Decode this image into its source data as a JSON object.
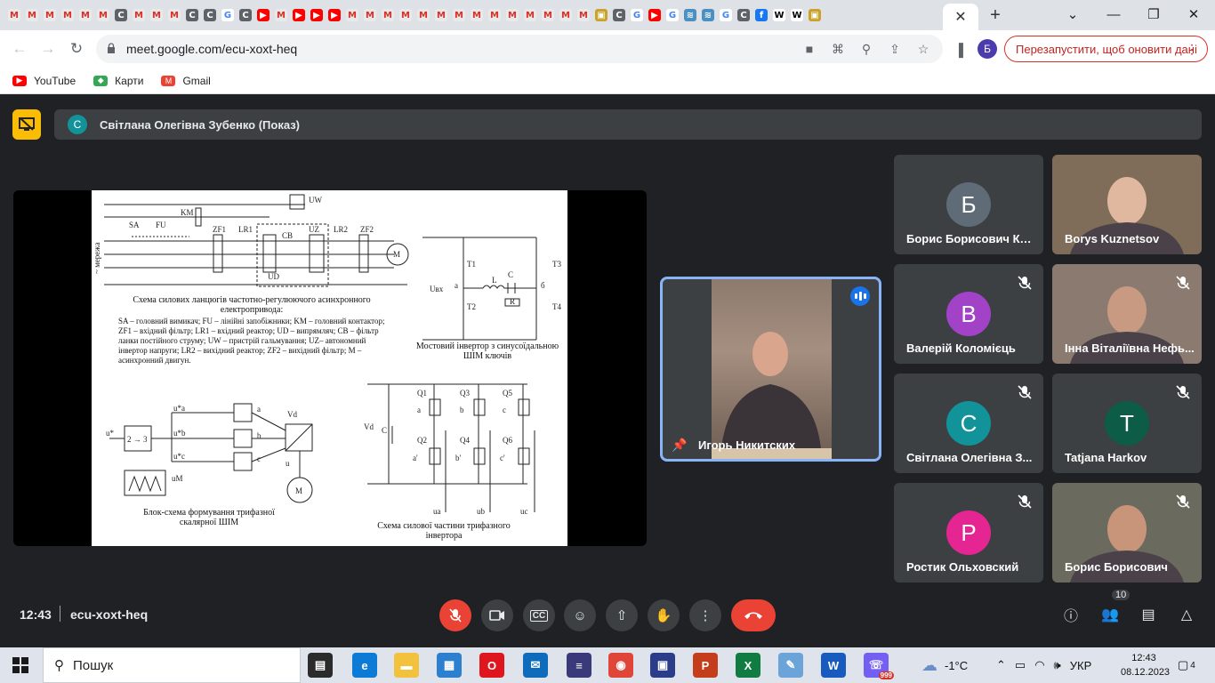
{
  "browser": {
    "active_tab_icon": "close-icon",
    "tab_favicons": [
      "M",
      "M",
      "M",
      "M",
      "M",
      "M",
      "C",
      "M",
      "M",
      "M",
      "C",
      "C",
      "G",
      "C",
      "▶",
      "M",
      "▶",
      "▶",
      "▶",
      "M",
      "M",
      "M",
      "M",
      "M",
      "M",
      "M",
      "M",
      "M",
      "M",
      "M",
      "M",
      "M",
      "M",
      "▣",
      "C",
      "G",
      "▶",
      "G",
      "≋",
      "≋",
      "G",
      "C",
      "f",
      "W",
      "W",
      "▣"
    ],
    "url": "meet.google.com/ecu-xoxt-heq",
    "profile_letter": "Б",
    "relaunch_label": "Перезапустити, щоб оновити дані",
    "bookmarks": [
      {
        "label": "YouTube",
        "color": "#ff0000",
        "icon": "youtube-icon"
      },
      {
        "label": "Карти",
        "color": "#34a853",
        "icon": "maps-icon"
      },
      {
        "label": "Gmail",
        "color": "#ea4335",
        "icon": "gmail-icon"
      }
    ]
  },
  "meet": {
    "presenter_letter": "С",
    "presenter_title": "Світлана Олегівна Зубенко (Показ)",
    "featured_name": "Игорь Никитских",
    "participants": [
      {
        "name": "Борис Борисович Ко...",
        "letter": "Б",
        "color": "#5f6b76",
        "muted": false,
        "video": false
      },
      {
        "name": "Borys Kuznetsov",
        "letter": "",
        "color": "",
        "muted": false,
        "video": true
      },
      {
        "name": "Валерій Коломієць",
        "letter": "В",
        "color": "#a142c7",
        "muted": true,
        "video": false
      },
      {
        "name": "Інна Віталіївна Нефь...",
        "letter": "",
        "color": "",
        "muted": true,
        "video": true
      },
      {
        "name": "Світлана Олегівна З...",
        "letter": "С",
        "color": "#12939a",
        "muted": true,
        "video": false
      },
      {
        "name": "Tatjana Harkov",
        "letter": "T",
        "color": "#0d5c47",
        "muted": true,
        "video": false
      },
      {
        "name": "Ростик Ольховский",
        "letter": "Р",
        "color": "#e52592",
        "muted": true,
        "video": false
      },
      {
        "name": "Борис Борисович",
        "letter": "",
        "color": "",
        "muted": true,
        "video": true
      }
    ],
    "time": "12:43",
    "meeting_code": "ecu-xoxt-heq",
    "people_count": "10"
  },
  "slide": {
    "caption1": "Схема силових ланцюгів частотно-регулюючого асинхронного електропривода:",
    "legend1": "SA – головний вимикач; FU – лінійні запобіжники; KM – головний контактор; ZF1 – вхідний фільтр; LR1 – вхідний реактор; UD – випрямляч; CB – фільтр ланки постійного струму; UW – пристрій гальмування; UZ– автономний інвертор напруги; LR2 – вихідний реактор; ZF2 – вихідний фільтр; M – асинхронний двигун.",
    "caption2": "Мостовий інвертор з синусоїдальною ШІМ ключів",
    "caption3": "Блок-схема формування трифазної скалярної ШІМ",
    "caption4": "Схема силової частини трифазного інвертора",
    "label_mains": "~ мережа",
    "labels_top": [
      "SA",
      "FU",
      "KM",
      "ZF1",
      "LR1",
      "CB",
      "UZ",
      "LR2",
      "ZF2",
      "UW",
      "UD",
      "M"
    ],
    "labels_bridge": [
      "T1",
      "T2",
      "T3",
      "T4",
      "Uвх",
      "a",
      "б",
      "L",
      "C",
      "R"
    ],
    "labels_block": [
      "u*",
      "2 → 3",
      "u*a",
      "u*b",
      "u*c",
      "a",
      "b",
      "c",
      "Vd",
      "u",
      "uM",
      "M"
    ],
    "labels_inverter": [
      "Vd",
      "C",
      "Q1",
      "Q3",
      "Q5",
      "Q2",
      "Q4",
      "Q6",
      "a",
      "b",
      "c",
      "a'",
      "b'",
      "c'",
      "ua",
      "ub",
      "uc"
    ]
  },
  "taskbar": {
    "search_label": "Пошук",
    "weather": "-1°C",
    "language": "УКР",
    "time": "12:43",
    "date": "08.12.2023",
    "notifications": "4",
    "viber_badge": "999",
    "apps": [
      {
        "name": "task-view-icon",
        "color": "#2b2b2b"
      },
      {
        "name": "edge-icon",
        "color": "#0c7bd6"
      },
      {
        "name": "explorer-icon",
        "color": "#f2c23c"
      },
      {
        "name": "store-icon",
        "color": "#2d7fd0"
      },
      {
        "name": "opera-icon",
        "color": "#e0161e"
      },
      {
        "name": "mail-icon",
        "color": "#0f6cbd"
      },
      {
        "name": "flag-icon",
        "color": "#3a3a7a"
      },
      {
        "name": "chrome-icon",
        "color": "#e0453a"
      },
      {
        "name": "save-icon",
        "color": "#2a3c8a"
      },
      {
        "name": "powerpoint-icon",
        "color": "#c43e1c"
      },
      {
        "name": "excel-icon",
        "color": "#107c41"
      },
      {
        "name": "paint-icon",
        "color": "#6aa4d8"
      },
      {
        "name": "word-icon",
        "color": "#185abd"
      },
      {
        "name": "viber-icon",
        "color": "#7360f2"
      }
    ]
  }
}
